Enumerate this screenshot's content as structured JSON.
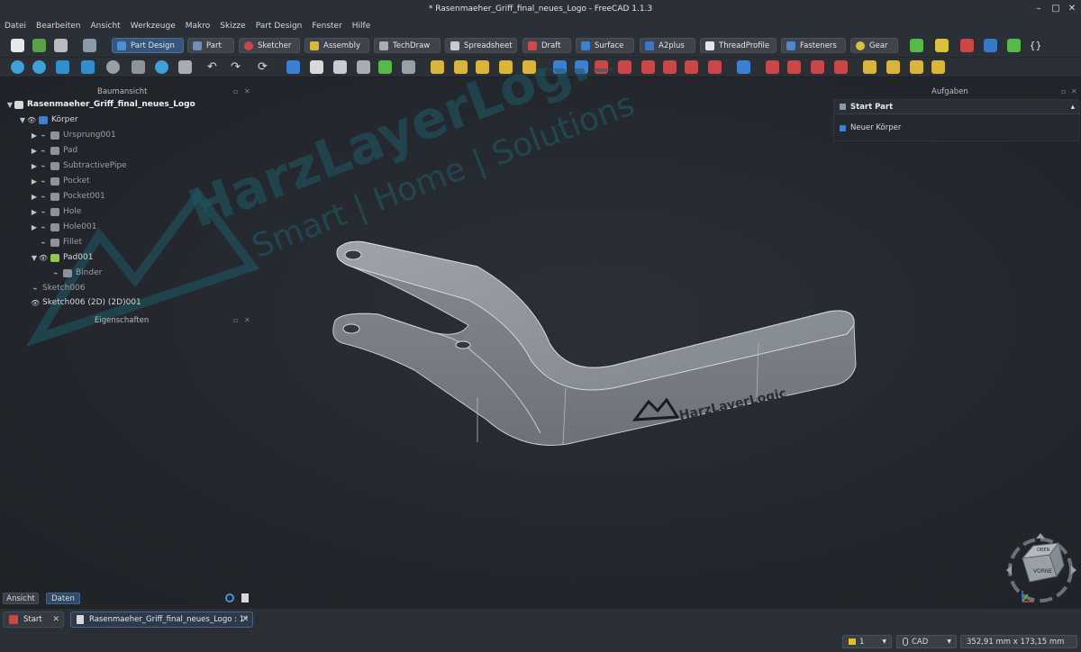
{
  "window": {
    "title": "* Rasenmaeher_Griff_final_neues_Logo - FreeCAD 1.1.3"
  },
  "menu": [
    "Datei",
    "Bearbeiten",
    "Ansicht",
    "Werkzeuge",
    "Makro",
    "Skizze",
    "Part Design",
    "Fenster",
    "Hilfe"
  ],
  "workbenches": [
    {
      "label": "Part Design",
      "active": true,
      "color": "#4a8fd8"
    },
    {
      "label": "Part",
      "active": false,
      "color": "#6f8fb5"
    },
    {
      "label": "Sketcher",
      "active": false,
      "color": "#c94747"
    },
    {
      "label": "Assembly",
      "active": false,
      "color": "#d9b93a"
    },
    {
      "label": "TechDraw",
      "active": false,
      "color": "#a9acb1"
    },
    {
      "label": "Spreadsheet",
      "active": false,
      "color": "#c8cbd0"
    },
    {
      "label": "Draft",
      "active": false,
      "color": "#d04a4a"
    },
    {
      "label": "Surface",
      "active": false,
      "color": "#3d7fd0"
    },
    {
      "label": "A2plus",
      "active": false,
      "color": "#3a77c7"
    },
    {
      "label": "ThreadProfile",
      "active": false,
      "color": "#e6e6e6"
    },
    {
      "label": "Fasteners",
      "active": false,
      "color": "#4f86c9"
    },
    {
      "label": "Gear",
      "active": false,
      "color": "#d9c13a"
    }
  ],
  "tree": {
    "title": "Baumansicht",
    "items": [
      {
        "label": "Rasenmaeher_Griff_final_neues_Logo",
        "bold": true,
        "dim": false
      },
      {
        "label": "Körper",
        "bold": false,
        "dim": false
      },
      {
        "label": "Ursprung001",
        "bold": false,
        "dim": true
      },
      {
        "label": "Pad",
        "bold": false,
        "dim": true
      },
      {
        "label": "SubtractivePipe",
        "bold": false,
        "dim": true
      },
      {
        "label": "Pocket",
        "bold": false,
        "dim": true
      },
      {
        "label": "Pocket001",
        "bold": false,
        "dim": true
      },
      {
        "label": "Hole",
        "bold": false,
        "dim": true
      },
      {
        "label": "Hole001",
        "bold": false,
        "dim": true
      },
      {
        "label": "Fillet",
        "bold": false,
        "dim": true
      },
      {
        "label": "Pad001",
        "bold": false,
        "dim": false
      },
      {
        "label": "Binder",
        "bold": false,
        "dim": true
      },
      {
        "label": "Sketch006",
        "bold": false,
        "dim": true
      },
      {
        "label": "Sketch006 (2D) (2D)001",
        "bold": false,
        "dim": false
      }
    ]
  },
  "properties": {
    "title": "Eigenschaften"
  },
  "tasks": {
    "title": "Aufgaben",
    "header": "Start Part",
    "action": "Neuer Körper"
  },
  "watermark": {
    "brand": "HarzLayerLogic",
    "tagline": "Smart | Home | Solutions"
  },
  "model": {
    "logo_text": "HarzLayerLogic"
  },
  "navcube": {
    "face_front": "VORNE",
    "face_top": "OBEN"
  },
  "bottom_tabs": [
    "Ansicht",
    "Daten"
  ],
  "doc_tabs": [
    {
      "label": "Start",
      "active": false
    },
    {
      "label": "Rasenmaeher_Griff_final_neues_Logo : 1*",
      "active": true
    }
  ],
  "status": {
    "nav_style": "CAD",
    "page_indicator": "1",
    "dimensions": "352,91 mm x 173,15 mm"
  }
}
